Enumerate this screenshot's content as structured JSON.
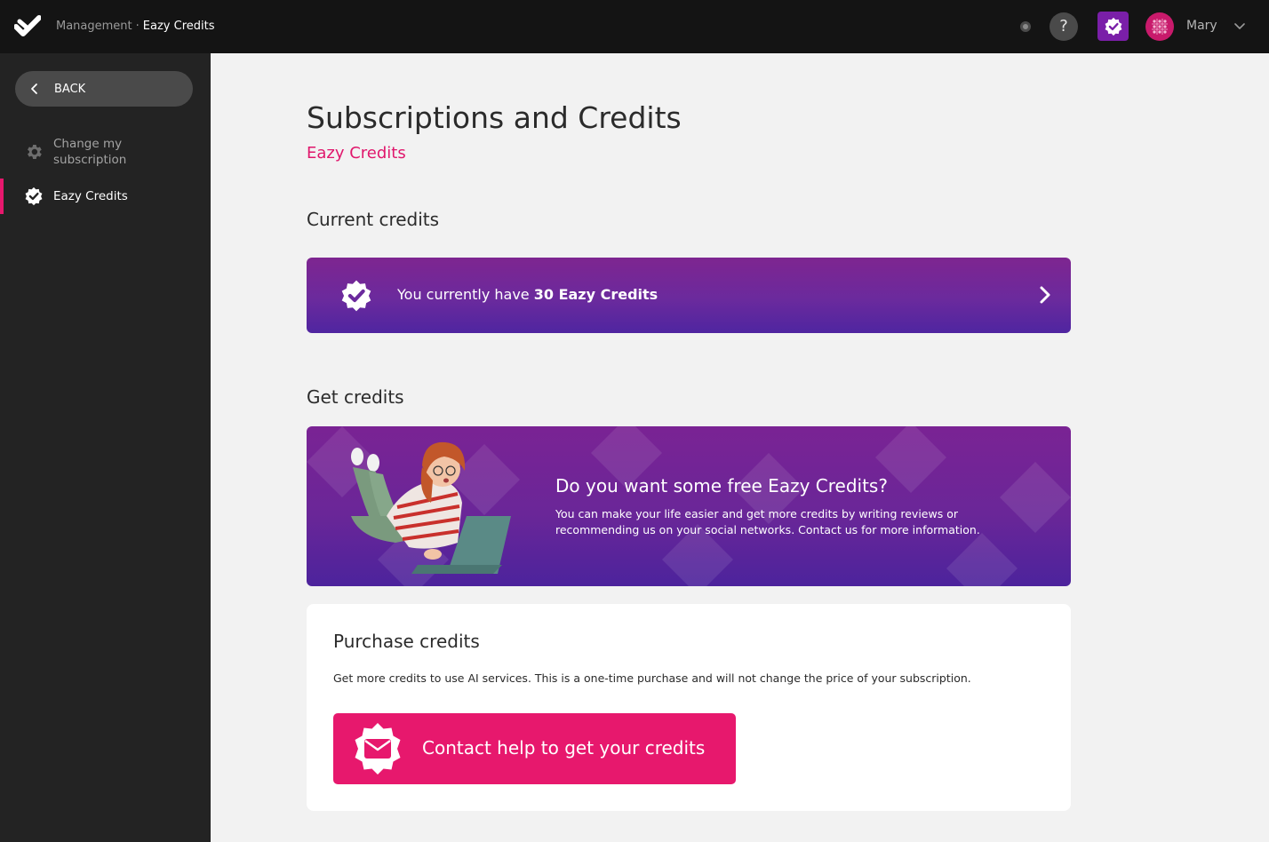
{
  "colors": {
    "accent_pink": "#e7186d",
    "purple": "#6a2698",
    "topbar": "#141414",
    "sidebar": "#232323"
  },
  "topbar": {
    "logo_icon": "checkmark-logo-icon",
    "breadcrumb": {
      "parent": "Management",
      "separator": "·",
      "current": "Eazy Credits"
    },
    "help_label": "?",
    "user_name": "Mary"
  },
  "sidebar": {
    "back_label": "BACK",
    "items": [
      {
        "label": "Change my subscription",
        "icon": "gear-icon",
        "active": false
      },
      {
        "label": "Eazy Credits",
        "icon": "verified-badge-icon",
        "active": true
      }
    ]
  },
  "main": {
    "title": "Subscriptions and Credits",
    "subtitle": "Eazy Credits",
    "current_heading": "Current credits",
    "credit_card": {
      "prefix": "You currently have",
      "amount": "30 Eazy Credits"
    },
    "get_heading": "Get credits",
    "promo": {
      "title": "Do you want some free Eazy Credits?",
      "body": "You can make your life easier and get more credits by writing reviews or recommending us on your social networks. Contact us for more information."
    },
    "purchase": {
      "heading": "Purchase credits",
      "description": "Get more credits to use AI services. This is a one-time purchase and will not change the price of your subscription.",
      "button_label": "Contact help to get your credits"
    }
  }
}
